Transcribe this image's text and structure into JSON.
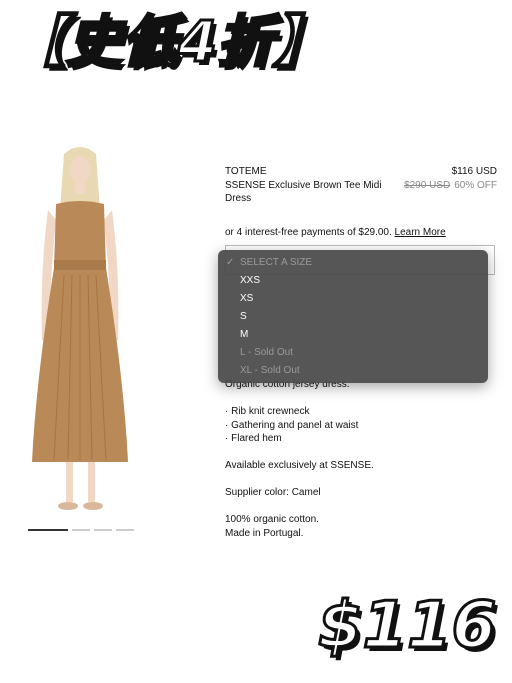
{
  "promo_banner": "【史低4折】",
  "price_stamp": "$116",
  "product": {
    "brand": "TOTEME",
    "name": "SSENSE Exclusive Brown Tee Midi Dress",
    "price": "$116 USD",
    "original_price": "$290 USD",
    "discount": "60% OFF",
    "installment_text": "or 4 interest-free payments of $29.00.",
    "installment_link": "Learn More"
  },
  "size_dropdown": {
    "options": [
      {
        "label": "SELECT A SIZE",
        "selected": true,
        "disabled": true
      },
      {
        "label": "XXS",
        "disabled": false
      },
      {
        "label": "XS",
        "disabled": false
      },
      {
        "label": "S",
        "disabled": false
      },
      {
        "label": "M",
        "disabled": false
      },
      {
        "label": "L - Sold Out",
        "disabled": true
      },
      {
        "label": "XL - Sold Out",
        "disabled": true
      }
    ]
  },
  "description": {
    "partial_line": "Organic cotton jersey dress.",
    "bullets": [
      "· Rib knit crewneck",
      "· Gathering and panel at waist",
      "· Flared hem"
    ],
    "exclusive": "Available exclusively at SSENSE.",
    "supplier_color": "Supplier color: Camel",
    "composition": "100% organic cotton.",
    "origin": "Made in Portugal."
  },
  "colors": {
    "dress": "#b98a57",
    "overlay": "#484848"
  }
}
